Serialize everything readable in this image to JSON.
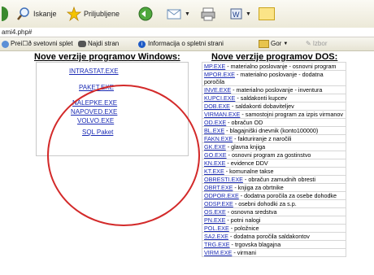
{
  "toolbar": {
    "search_label": "Iskanje",
    "favorites_label": "Priljubljene",
    "flag_label": "Izbor"
  },
  "address": {
    "url": "ami4.php#"
  },
  "linksbar": {
    "items": [
      "Prei☐ð svetovni splet",
      "Najdi stran",
      "Informacija o spletni strani",
      "Gor"
    ]
  },
  "left": {
    "heading": "Nove verzije programov Windows:",
    "links": [
      "INTRASTAT.EXE",
      "PAKET.EXE",
      "NALEPKE.EXE",
      "NAPOVED.EXE",
      "VOLVO.EXE",
      "SQL Paket"
    ]
  },
  "right": {
    "heading": "Nove verzije programov DOS:",
    "rows": [
      {
        "name": "MP.EXE",
        "desc": " - materialno poslovanje - osnovni program"
      },
      {
        "name": "MPOR.EXE",
        "desc": " - materialno poslovanje - dodatna poročila"
      },
      {
        "name": "INVE.EXE",
        "desc": " - materialno poslovanje - inventura"
      },
      {
        "name": "KUPCI.EXE",
        "desc": " - saldakonti kupcev"
      },
      {
        "name": "DOB.EXE",
        "desc": " - saldakonti dobaviteljev"
      },
      {
        "name": "VIRMAN.EXE",
        "desc": " - samostojni program za izpis virmanov"
      },
      {
        "name": "OD.EXE",
        "desc": " - obračun OD"
      },
      {
        "name": "BL.EXE",
        "desc": " - blagajniški dnevnik (konto100000)"
      },
      {
        "name": "FAKN.EXE",
        "desc": " - fakturiranje z naročili"
      },
      {
        "name": "GK.EXE",
        "desc": " - glavna knjiga"
      },
      {
        "name": "GO.EXE",
        "desc": " - osnovni program za gostinstvo"
      },
      {
        "name": "KN.EXE",
        "desc": " - evidence DDV"
      },
      {
        "name": "KT.EXE",
        "desc": " - komunalne takse"
      },
      {
        "name": "OBRESTI.EXE",
        "desc": " - obračun zamudnih obresti"
      },
      {
        "name": "OBRT.EXE",
        "desc": " - knjiga za obrtnike"
      },
      {
        "name": "ODPOR.EXE",
        "desc": " - dodatna poročila za osebe dohodke"
      },
      {
        "name": "ODSP.EXE",
        "desc": " - osebni dohodki za s.p."
      },
      {
        "name": "OS.EXE",
        "desc": " - osnovna sredstva"
      },
      {
        "name": "PN.EXE",
        "desc": " - potni nalogi"
      },
      {
        "name": "POL.EXE",
        "desc": " - položnice"
      },
      {
        "name": "SA2.EXE",
        "desc": " - dodatna poročila saldakontov"
      },
      {
        "name": "TRG.EXE",
        "desc": " - trgovska blagajna"
      },
      {
        "name": "VIRM.EXE",
        "desc": " - virmani"
      }
    ]
  },
  "colors": {
    "link": "#1b2bb4",
    "annotation": "#d32a2a"
  }
}
